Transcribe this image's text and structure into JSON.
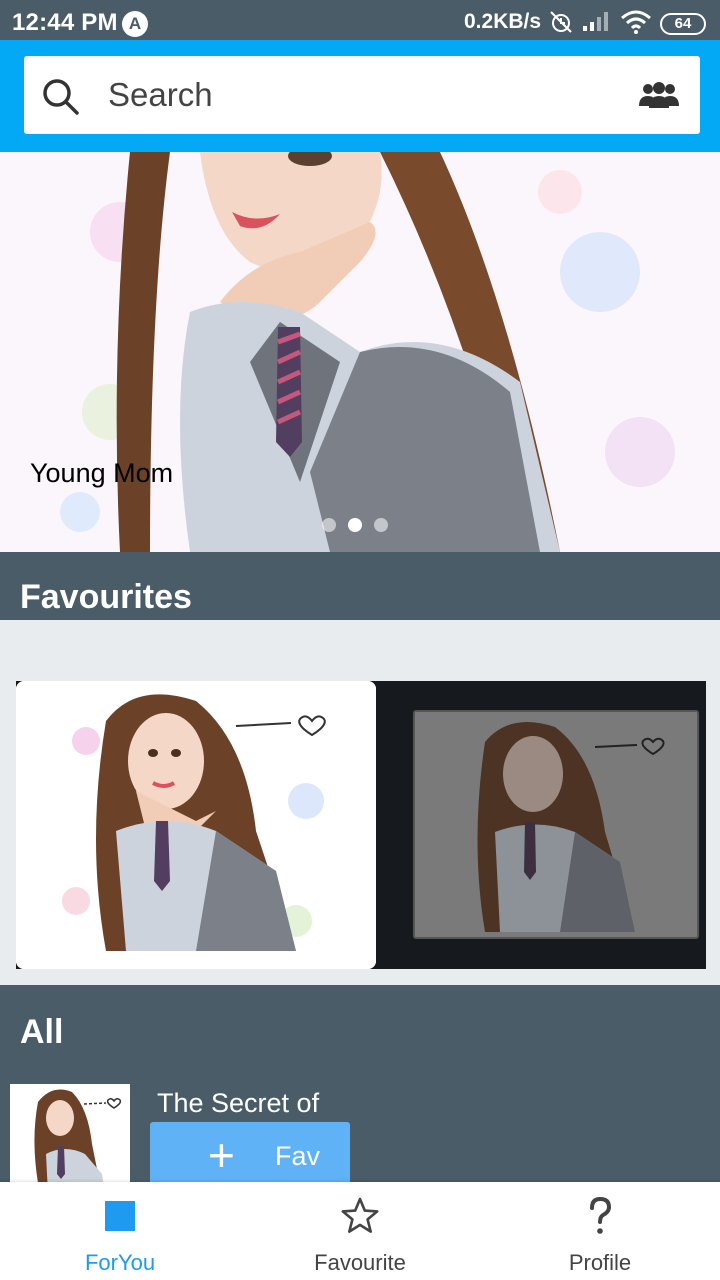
{
  "status_bar": {
    "time": "12:44 PM",
    "app_icon": "A",
    "speed": "0.2KB/s",
    "battery": "64",
    "icons": [
      "alarm-off-icon",
      "signal-icon",
      "wifi-icon",
      "battery-icon"
    ]
  },
  "search": {
    "placeholder": "Search",
    "right_icon": "people-icon"
  },
  "banner": {
    "caption": "Young Mom",
    "slide_count": 3,
    "active_slide": 2
  },
  "favourites": {
    "title": "Favourites"
  },
  "all": {
    "title": "All",
    "items": [
      {
        "title": "The Secret of",
        "button_label": "Fav"
      }
    ]
  },
  "bottom_nav": {
    "items": [
      {
        "label": "ForYou",
        "icon": "square-icon",
        "active": true
      },
      {
        "label": "Favourite",
        "icon": "star-icon",
        "active": false
      },
      {
        "label": "Profile",
        "icon": "question-icon",
        "active": false
      }
    ]
  },
  "colors": {
    "status_bar": "#4a5c68",
    "header": "#03a9f4",
    "section": "#4a5c68",
    "accent": "#1e9bf0",
    "fav_button": "#5fb2f5"
  }
}
